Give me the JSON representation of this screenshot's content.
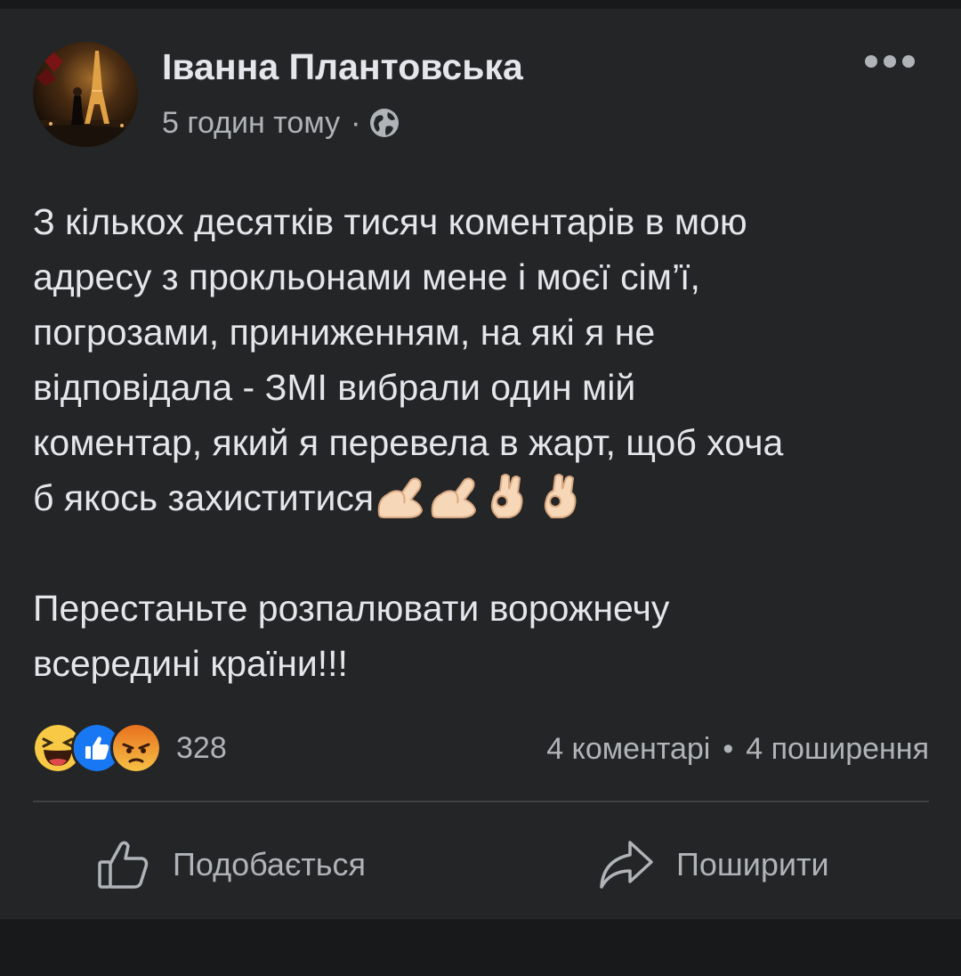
{
  "post": {
    "author": "Іванна Плантовська",
    "time": "5 годин тому",
    "separator": "·",
    "privacy_icon": "globe-icon",
    "body_lines": [
      "З кількох десятків тисяч коментарів в мою",
      "адресу з прокльонами мене і моєї сім’ї,",
      "погрозами, приниженням, на які я не",
      "відповідала - ЗМІ вибрали один мій",
      "коментар, який я перевела в жарт, щоб хоча",
      "б якось захиститися"
    ],
    "body_emojis": [
      "flexed-biceps",
      "flexed-biceps",
      "ok-hand",
      "ok-hand"
    ],
    "closing_lines": [
      "Перестаньте розпалювати ворожнечу",
      "всередині країни!!!"
    ]
  },
  "reactions": {
    "icons": [
      "haha-reaction-icon",
      "like-reaction-icon",
      "angry-reaction-icon"
    ],
    "count": "328"
  },
  "stats": {
    "comments": "4 коментарі",
    "separator": "•",
    "shares": "4 поширення"
  },
  "actions": {
    "like_label": "Подобається",
    "share_label": "Поширити"
  },
  "colors": {
    "background": "#18191a",
    "card": "#242526",
    "primary_text": "#e4e6eb",
    "secondary_text": "#b0b3b8",
    "like_blue": "#1877f2",
    "haha_yellow": "#f7c944",
    "angry_orange": "#e8701f"
  }
}
